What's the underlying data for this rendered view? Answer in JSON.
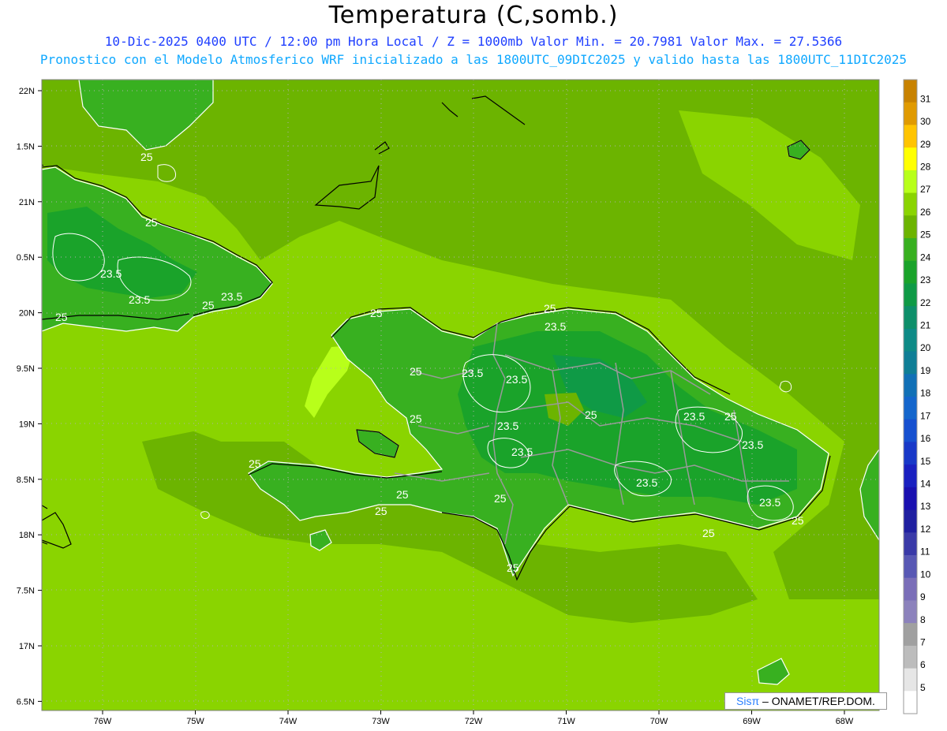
{
  "header": {
    "title": "Temperatura (C,somb.)",
    "line1": "10-Dic-2025 0400 UTC / 12:00 pm Hora Local / Z = 1000mb  Valor Min. = 20.7981  Valor Max. = 27.5366",
    "line2": "Pronostico con el Modelo Atmosferico WRF inicializado a las 1800UTC_09DIC2025 y valido hasta las  1800UTC_11DIC2025"
  },
  "map": {
    "lat_labels": [
      "22N",
      "1.5N",
      "21N",
      "0.5N",
      "20N",
      "9.5N",
      "19N",
      "8.5N",
      "18N",
      "7.5N",
      "17N",
      "6.5N"
    ],
    "lon_labels": [
      "76W",
      "75W",
      "74W",
      "73W",
      "72W",
      "71W",
      "70W",
      "69W",
      "68W"
    ],
    "contour_labels": [
      {
        "text": "25",
        "id": "c1"
      },
      {
        "text": "25",
        "id": "c2"
      },
      {
        "text": "23.5",
        "id": "c3"
      },
      {
        "text": "23.5",
        "id": "c4"
      },
      {
        "text": "25",
        "id": "c5"
      },
      {
        "text": "23.5",
        "id": "c6"
      },
      {
        "text": "25",
        "id": "c7"
      },
      {
        "text": "25",
        "id": "c8"
      },
      {
        "text": "23.5",
        "id": "c9"
      },
      {
        "text": "25",
        "id": "c10"
      },
      {
        "text": "23.5",
        "id": "c11"
      },
      {
        "text": "23.5",
        "id": "c12"
      },
      {
        "text": "25",
        "id": "c13"
      },
      {
        "text": "23.5",
        "id": "c14"
      },
      {
        "text": "23.5",
        "id": "c15"
      },
      {
        "text": "25",
        "id": "c16"
      },
      {
        "text": "25",
        "id": "c17"
      },
      {
        "text": "25",
        "id": "c18"
      },
      {
        "text": "25",
        "id": "c19"
      },
      {
        "text": "23.5",
        "id": "c20"
      },
      {
        "text": "25",
        "id": "c21"
      },
      {
        "text": "23.5",
        "id": "c22"
      },
      {
        "text": "25",
        "id": "c23"
      },
      {
        "text": "23.5",
        "id": "c24"
      },
      {
        "text": "25",
        "id": "c25"
      },
      {
        "text": "23.5",
        "id": "c26"
      },
      {
        "text": "25",
        "id": "c27"
      },
      {
        "text": "25",
        "id": "c28"
      },
      {
        "text": "25",
        "id": "c29"
      }
    ]
  },
  "colorbar": {
    "labels": [
      "31",
      "30",
      "29",
      "28",
      "27",
      "26",
      "25",
      "24",
      "23",
      "22",
      "21",
      "20",
      "19",
      "18",
      "17",
      "16",
      "15",
      "14",
      "13",
      "12",
      "11",
      "10",
      "9",
      "8",
      "7",
      "6",
      "5"
    ],
    "colors": [
      "#c88200",
      "#e09a00",
      "#ffc400",
      "#ffff00",
      "#b8ff1a",
      "#8ad400",
      "#6cb400",
      "#38b020",
      "#1aa32a",
      "#0f9a46",
      "#0e8f6a",
      "#0e8a86",
      "#0f7e96",
      "#1170b6",
      "#1466cc",
      "#1650d0",
      "#1838c8",
      "#1a20c0",
      "#1a10b0",
      "#2020a0",
      "#3a3aa8",
      "#5858b4",
      "#7a6eb8",
      "#8c82bc",
      "#a0a0a0",
      "#bcbcbc",
      "#e6e6e6",
      "#ffffff"
    ]
  },
  "credit": {
    "brand": "Sisπ",
    "text": " – ONAMET/REP.DOM."
  },
  "colors": {
    "sea_warm": "#8ad400",
    "land_mid": "#6cb400",
    "land_cool": "#38b020"
  }
}
